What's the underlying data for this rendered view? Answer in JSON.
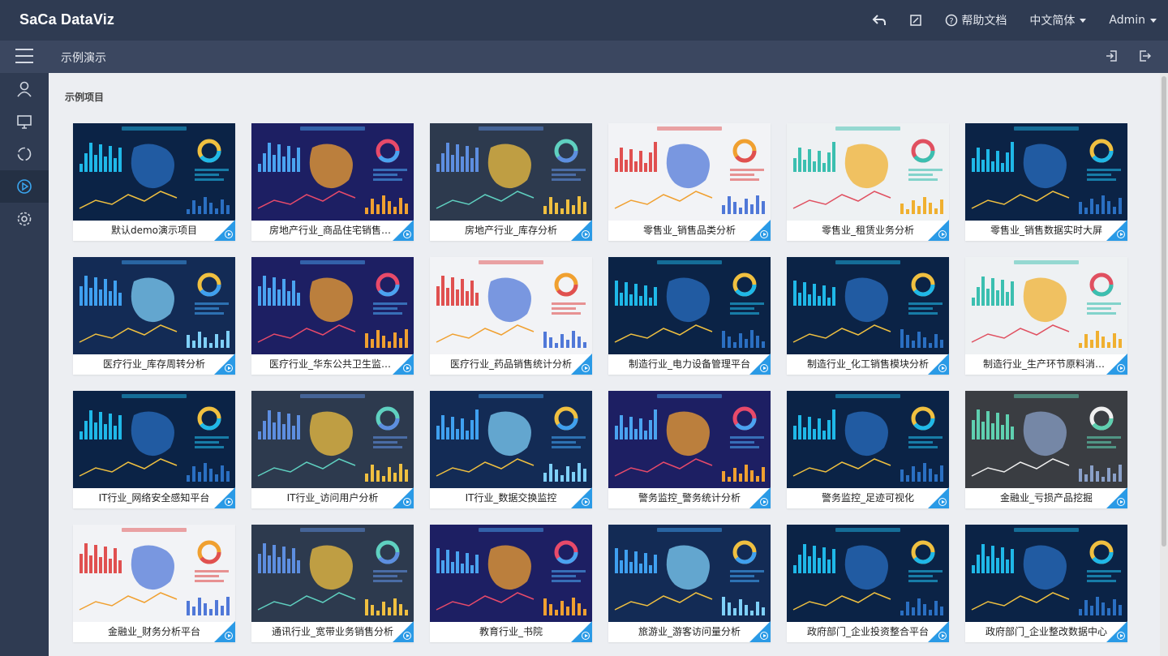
{
  "header": {
    "logo": "SaCa DataViz",
    "help_label": "帮助文档",
    "language": "中文简体",
    "user": "Admin"
  },
  "subbar": {
    "breadcrumb": "示例演示"
  },
  "section_title": "示例项目",
  "sidebar": {
    "items": [
      "user-icon",
      "monitor-icon",
      "refresh-icon",
      "play-circle-icon",
      "gear-icon"
    ],
    "active_index": 3
  },
  "projects": [
    {
      "label": "默认demo演示项目",
      "theme": "dark"
    },
    {
      "label": "房地产行业_商品住宅销售分析",
      "theme": "purple"
    },
    {
      "label": "房地产行业_库存分析",
      "theme": "slate"
    },
    {
      "label": "零售业_销售品类分析",
      "theme": "light"
    },
    {
      "label": "零售业_租赁业务分析",
      "theme": "light2"
    },
    {
      "label": "零售业_销售数据实时大屏",
      "theme": "dark"
    },
    {
      "label": "医疗行业_库存周转分析",
      "theme": "navy"
    },
    {
      "label": "医疗行业_华东公共卫生监管平台",
      "theme": "purple"
    },
    {
      "label": "医疗行业_药品销售统计分析",
      "theme": "light"
    },
    {
      "label": "制造行业_电力设备管理平台",
      "theme": "dark"
    },
    {
      "label": "制造行业_化工销售模块分析",
      "theme": "dark"
    },
    {
      "label": "制造行业_生产环节原料消耗分析",
      "theme": "light2"
    },
    {
      "label": "IT行业_网络安全感知平台",
      "theme": "dark"
    },
    {
      "label": "IT行业_访问用户分析",
      "theme": "slate"
    },
    {
      "label": "IT行业_数据交换监控",
      "theme": "navy"
    },
    {
      "label": "警务监控_警务统计分析",
      "theme": "purple"
    },
    {
      "label": "警务监控_足迹可视化",
      "theme": "dark"
    },
    {
      "label": "金融业_亏损产品挖掘",
      "theme": "gray"
    },
    {
      "label": "金融业_财务分析平台",
      "theme": "light"
    },
    {
      "label": "通讯行业_宽带业务销售分析",
      "theme": "slate"
    },
    {
      "label": "教育行业_书院",
      "theme": "purple"
    },
    {
      "label": "旅游业_游客访问量分析",
      "theme": "navy"
    },
    {
      "label": "政府部门_企业投资整合平台",
      "theme": "dark"
    },
    {
      "label": "政府部门_企业整改数据中心",
      "theme": "dark"
    }
  ],
  "colors": {
    "topbar": "#2f3b52",
    "subbar": "#3b4760",
    "accent": "#2a9ae6"
  }
}
